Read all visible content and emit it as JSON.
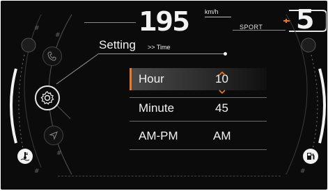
{
  "header": {
    "speed": "195",
    "speed_unit": "km/h",
    "drive_mode": "SPORT",
    "gear": "5"
  },
  "menu": {
    "title": "Setting",
    "breadcrumb": ">> Time",
    "side_icons": [
      "phone-icon",
      "settings-icon",
      "navigation-icon"
    ],
    "rows": [
      {
        "label": "Hour",
        "value": "10",
        "selected": true
      },
      {
        "label": "Minute",
        "value": "45",
        "selected": false
      },
      {
        "label": "AM-PM",
        "value": "AM",
        "selected": false
      }
    ]
  },
  "gauges": {
    "left_icon": "coolant-temperature-icon",
    "right_icon": "fuel-pump-icon"
  },
  "colors": {
    "accent": "#e87a2a",
    "background": "#0b0b0b",
    "text": "#f2f2f2"
  }
}
